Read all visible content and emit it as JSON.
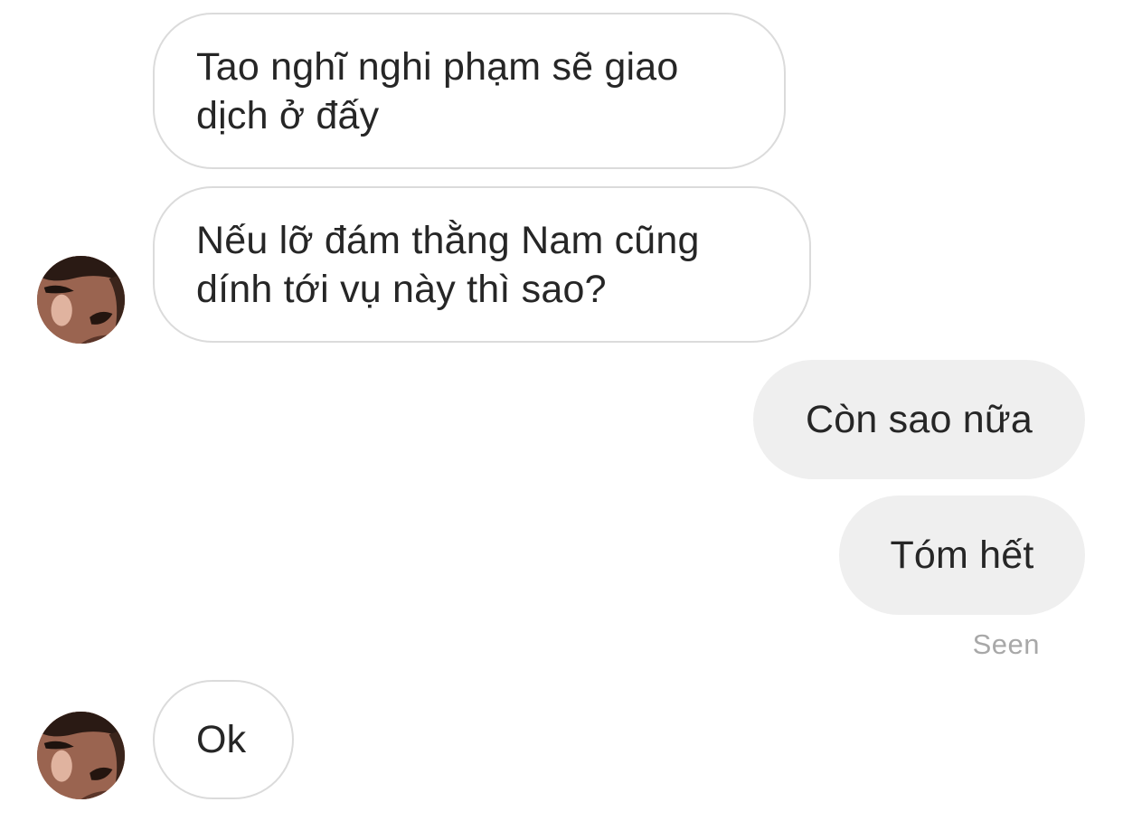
{
  "conversation": {
    "messages": [
      {
        "sender": "other",
        "text": "Tao nghĩ nghi phạm sẽ giao\ndịch ở đấy"
      },
      {
        "sender": "other",
        "text": "Nếu lỡ đám thằng Nam cũng\ndính tới vụ này thì sao?"
      },
      {
        "sender": "me",
        "text": "Còn sao nữa"
      },
      {
        "sender": "me",
        "text": "Tóm hết"
      },
      {
        "sender": "other",
        "text": "Ok"
      }
    ],
    "seen_label": "Seen"
  },
  "colors": {
    "incoming_bubble_border": "#dbdbdb",
    "outgoing_bubble_bg": "#efefef",
    "text": "#262626",
    "seen_text": "#a8a8a8"
  },
  "icons": {
    "avatar": "contact-avatar-photo"
  }
}
